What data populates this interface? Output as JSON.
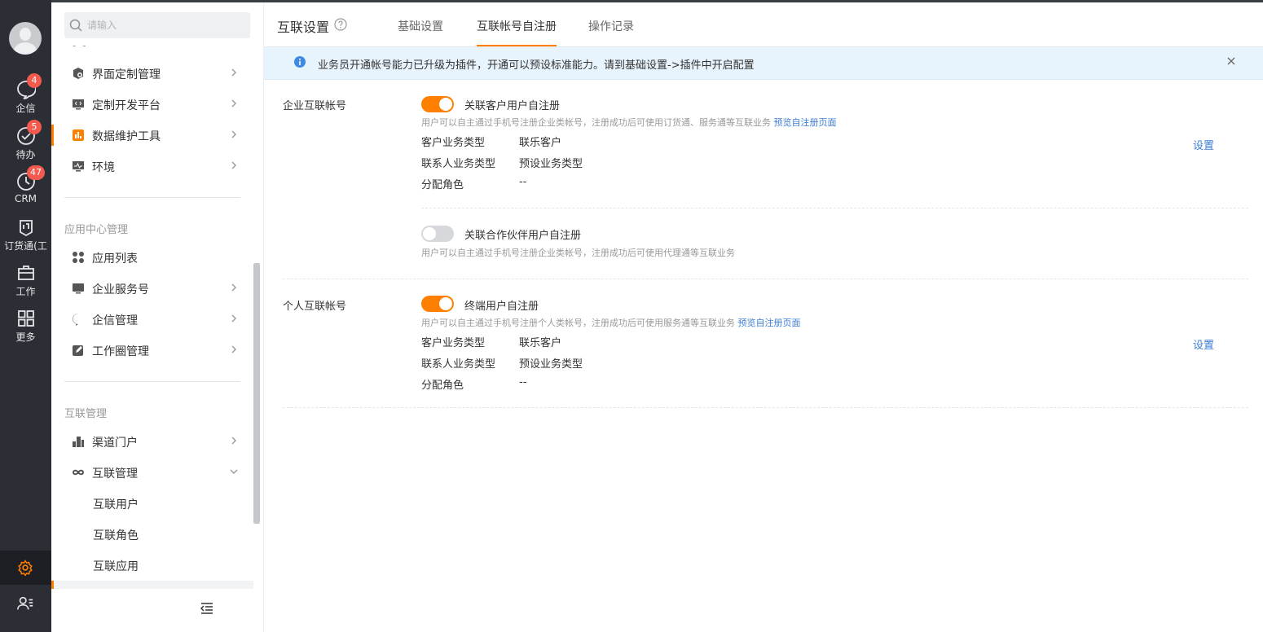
{
  "rail": {
    "items": [
      {
        "label": "企信",
        "badge": "4",
        "icon": "chat-icon"
      },
      {
        "label": "待办",
        "badge": "5",
        "icon": "check-circle-icon"
      },
      {
        "label": "CRM",
        "badge": "47",
        "icon": "crm-icon"
      },
      {
        "label": "订货通(工",
        "badge": "",
        "icon": "order-icon"
      },
      {
        "label": "工作",
        "badge": "",
        "icon": "briefcase-icon"
      },
      {
        "label": "更多",
        "badge": "",
        "icon": "grid-icon"
      }
    ]
  },
  "sidebar": {
    "search_placeholder": "请输入",
    "dashes": "- -",
    "group1": [
      {
        "label": "界面定制管理",
        "icon": "ui-custom-icon"
      },
      {
        "label": "定制开发平台",
        "icon": "dev-platform-icon"
      },
      {
        "label": "数据维护工具",
        "icon": "chart-bar-icon"
      },
      {
        "label": "环境",
        "icon": "monitor-icon"
      }
    ],
    "section2_title": "应用中心管理",
    "group2": [
      {
        "label": "应用列表",
        "icon": "apps-icon"
      },
      {
        "label": "企业服务号",
        "icon": "screen-icon"
      },
      {
        "label": "企信管理",
        "icon": "message-icon"
      },
      {
        "label": "工作圈管理",
        "icon": "edit-icon"
      }
    ],
    "section3_title": "互联管理",
    "group3": [
      {
        "label": "渠道门户",
        "icon": "building-icon"
      },
      {
        "label": "互联管理",
        "icon": "link-icon"
      }
    ],
    "sub_items": [
      "互联用户",
      "互联角色",
      "互联应用"
    ]
  },
  "header": {
    "title": "互联设置",
    "tabs": [
      "基础设置",
      "互联帐号自注册",
      "操作记录"
    ]
  },
  "notice": {
    "text": "业务员开通帐号能力已升级为插件，开通可以预设标准能力。请到基础设置->插件中开启配置"
  },
  "enterprise": {
    "label": "企业互联帐号",
    "customer": {
      "enabled": true,
      "title": "关联客户用户自注册",
      "desc": "用户可以自主通过手机号注册企业类帐号，注册成功后可使用订货通、服务通等互联业务",
      "preview_link": "预览自注册页面",
      "rows": [
        {
          "k": "客户业务类型",
          "v": "联乐客户"
        },
        {
          "k": "联系人业务类型",
          "v": "预设业务类型"
        },
        {
          "k": "分配角色",
          "v": "--"
        }
      ],
      "settings_link": "设置"
    },
    "partner": {
      "enabled": false,
      "title": "关联合作伙伴用户自注册",
      "desc": "用户可以自主通过手机号注册企业类帐号，注册成功后可使用代理通等互联业务"
    }
  },
  "personal": {
    "label": "个人互联帐号",
    "terminal": {
      "enabled": true,
      "title": "终端用户自注册",
      "desc": "用户可以自主通过手机号注册个人类帐号，注册成功后可使用服务通等互联业务",
      "preview_link": "预览自注册页面",
      "rows": [
        {
          "k": "客户业务类型",
          "v": "联乐客户"
        },
        {
          "k": "联系人业务类型",
          "v": "预设业务类型"
        },
        {
          "k": "分配角色",
          "v": "--"
        }
      ],
      "settings_link": "设置"
    }
  },
  "colors": {
    "accent": "#ff8000",
    "link": "#3d7dd6",
    "rail_bg": "#2b2e35",
    "badge": "#f55a4e"
  }
}
